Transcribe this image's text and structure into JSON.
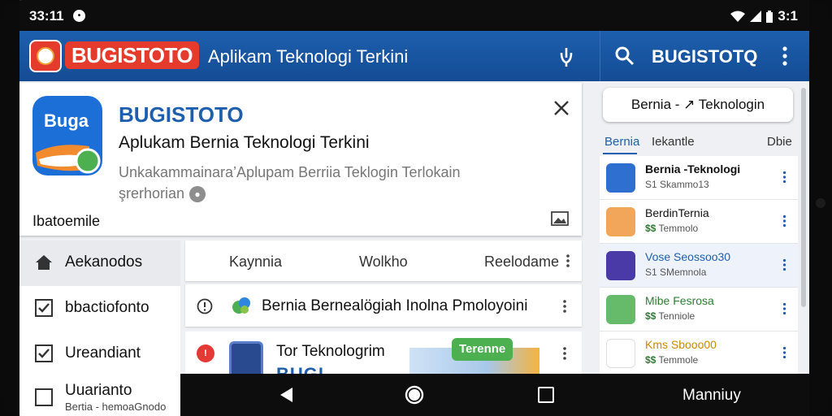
{
  "status_bar": {
    "time": "33:11",
    "right_text": "3:1",
    "icons": [
      "notification-icon",
      "wifi-icon",
      "signal-icon",
      "battery-icon"
    ]
  },
  "app_bar": {
    "logo_text": "BUGISTOTO",
    "title": "Aplikam Teknologi Terkini",
    "right_brand": "BUGISTOTQ",
    "icons": [
      "mic-icon",
      "search-icon",
      "more-vert-icon"
    ]
  },
  "card": {
    "icon_text": "Buɡa",
    "title": "BUGISTOTO",
    "subtitle": "Aplukam Bernia Teknologi Terkini",
    "description": "Unkakammainara’Aplupam Berriia Teklogin Terlokain",
    "description2": "şrerhorian",
    "footer": "Ibatoemile",
    "close_icon": "close-icon",
    "footer_icon": "image-icon"
  },
  "left_nav": {
    "items": [
      {
        "label": "Aekanodos",
        "icon": "home-icon",
        "active": true
      },
      {
        "label": "bbactiofonto",
        "icon": "checkbox-checked-icon"
      },
      {
        "label": "Ureandiant",
        "icon": "checkbox-checked-icon"
      },
      {
        "label": "Uuarianto",
        "sub": "Bertia - hemoaGnodo",
        "icon": "checkbox-empty-icon"
      }
    ]
  },
  "center": {
    "tabs": [
      "Kaynnia",
      "Wolkho",
      "Reelodame"
    ],
    "row1_text": "Bernia Bernealögiah Inolna Pmoloyoini",
    "row2_title": "Tor Teknologrim",
    "row2_block": "BUGI",
    "row2_tag": "Terenne",
    "row2_badge": "!"
  },
  "right_panel": {
    "search_label": "Bernia - ↗ Teknologin",
    "tabs": [
      "Bernia",
      "Iekantle",
      "Dbie"
    ],
    "items": [
      {
        "title": "Bernia -Teknologi",
        "sub": "S1 Skammo13",
        "color": "#2e6fcf"
      },
      {
        "title": "BerdinTernia",
        "sub": "Temmolo",
        "sub_prefix": "$$",
        "color": "#f2a65a"
      },
      {
        "title": "Vose Seossoo30",
        "sub": "S1 SMemnola",
        "color": "#4a3aa8",
        "highlight": true
      },
      {
        "title": "Mibe Fesrosa",
        "sub": "Tenniole",
        "sub_prefix": "$$",
        "color": "#66bb6a"
      },
      {
        "title": "Kms Sbooo00",
        "sub": "Temmole",
        "sub_prefix": "$$",
        "color": "#ffffff"
      }
    ]
  },
  "nav_bar": {
    "label": "Manniuy",
    "icons": [
      "back-icon",
      "home-circle-icon",
      "recents-icon"
    ]
  },
  "colors": {
    "primary": "#1d5fae",
    "accent_red": "#e43b2c",
    "green": "#4caf50"
  }
}
